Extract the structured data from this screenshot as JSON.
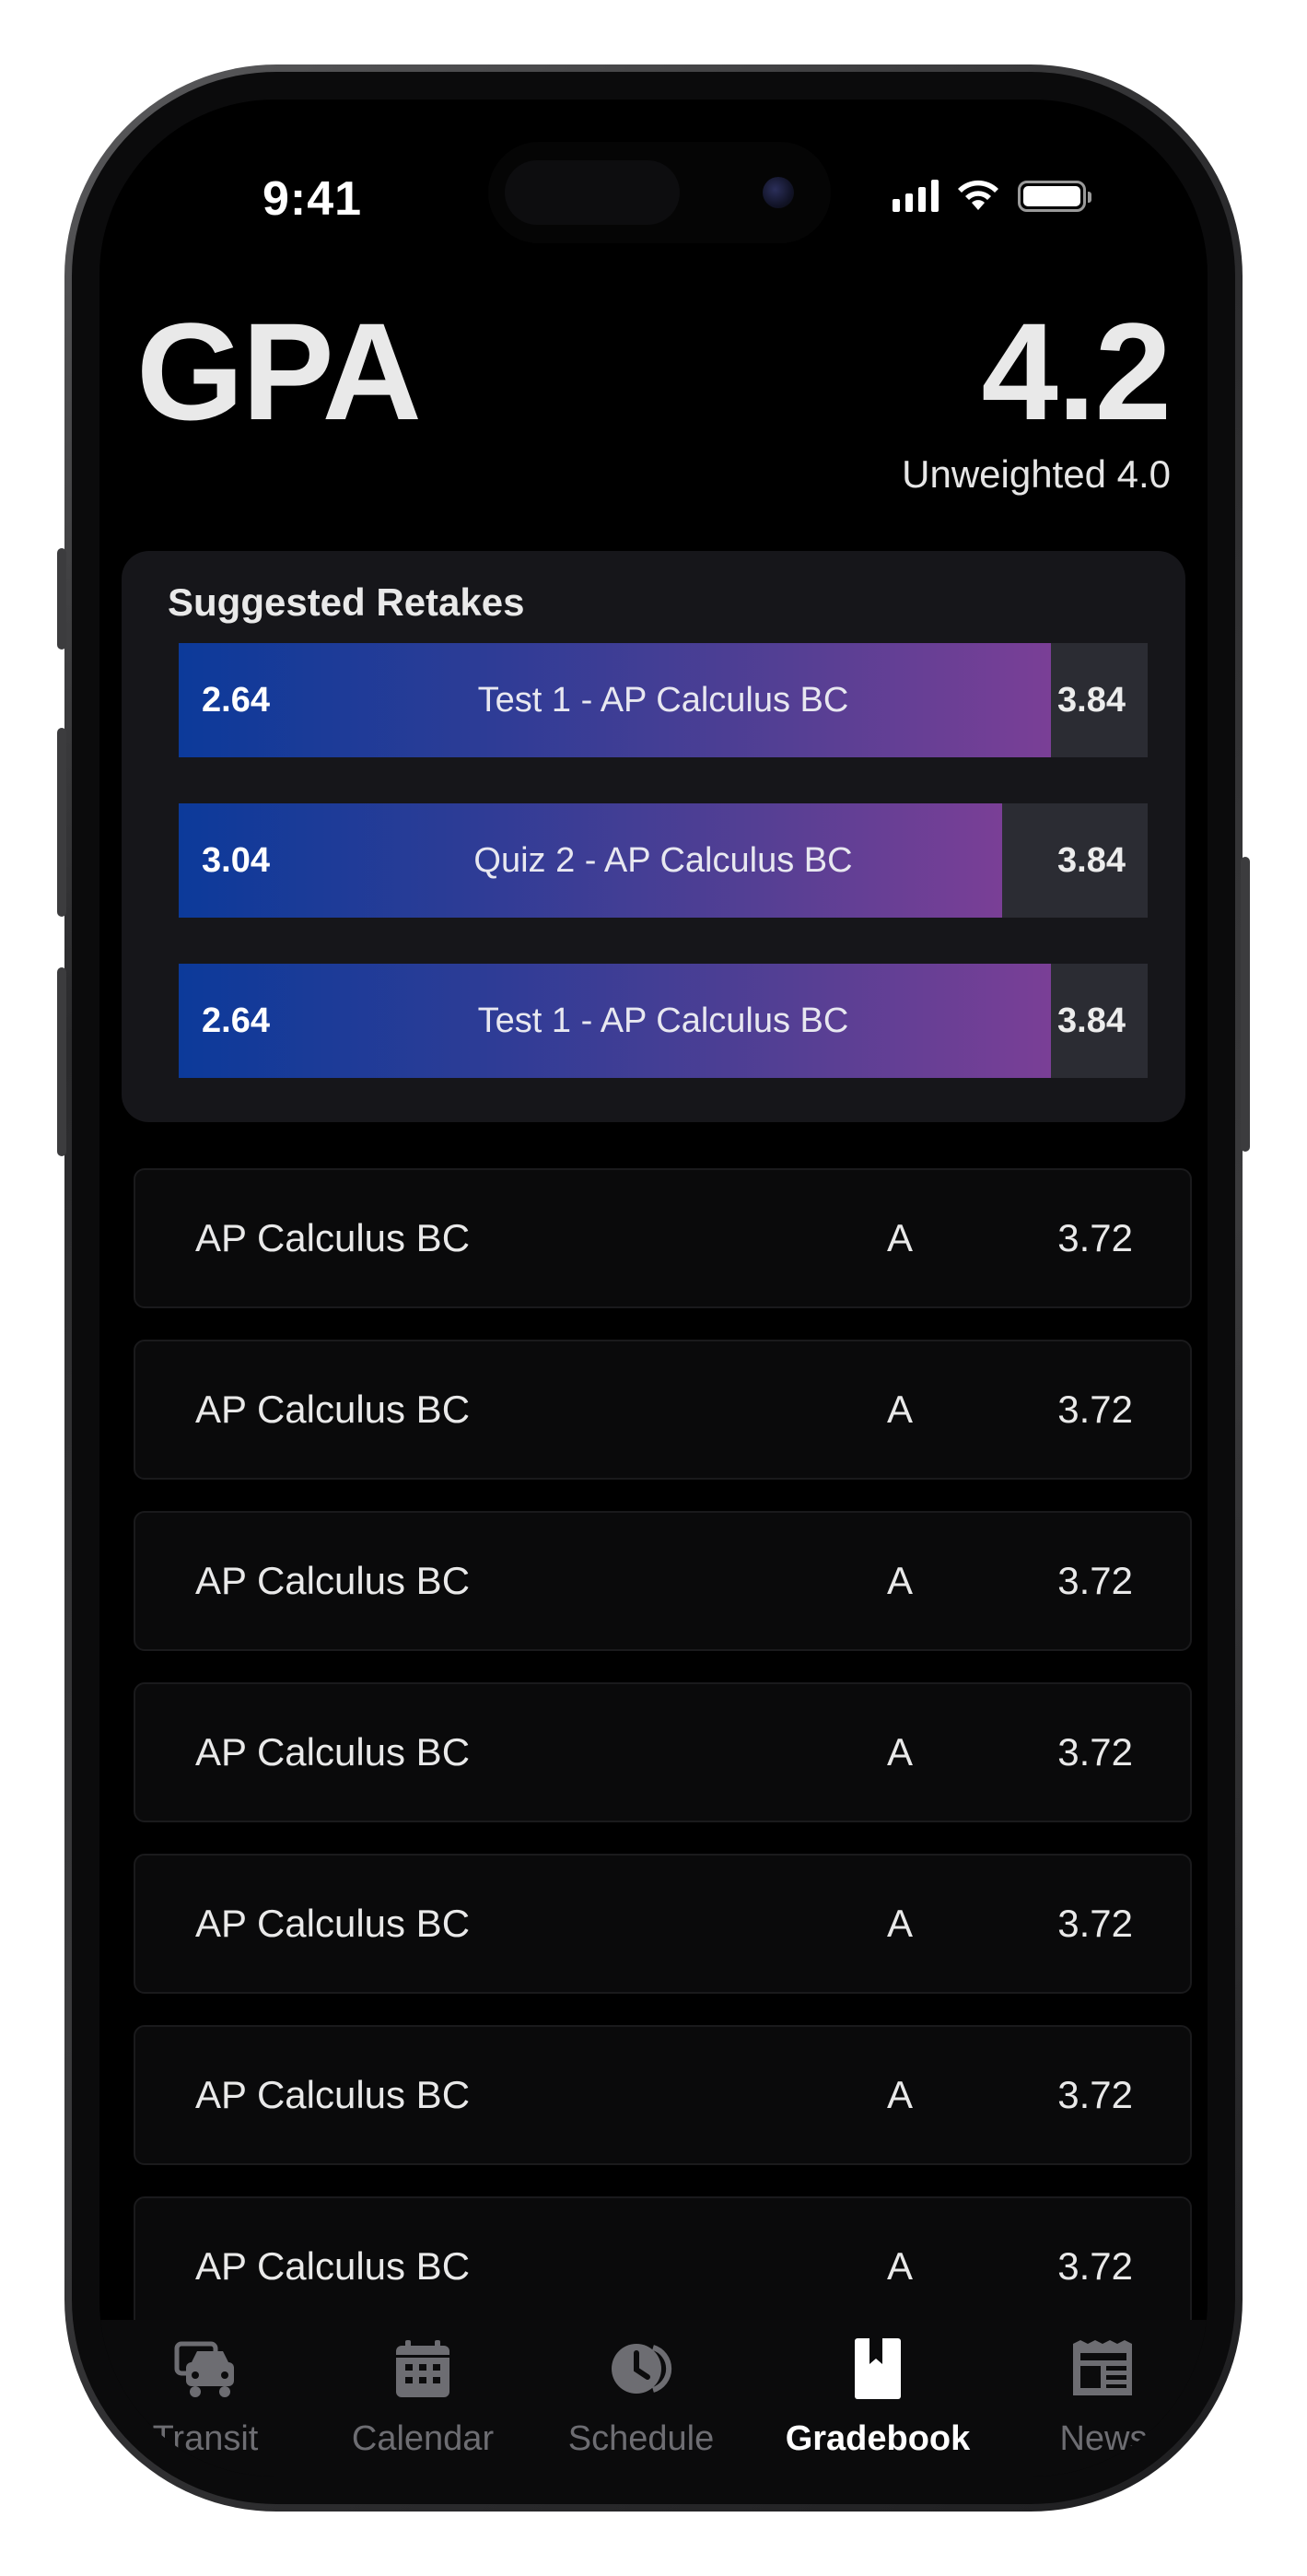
{
  "status_bar": {
    "time": "9:41"
  },
  "header": {
    "title": "GPA",
    "gpa": "4.2",
    "unweighted": "Unweighted 4.0"
  },
  "retakes": {
    "title": "Suggested Retakes",
    "items": [
      {
        "from": "2.64",
        "label": "Test 1 - AP Calculus BC",
        "to": "3.84",
        "progress": 0.9
      },
      {
        "from": "3.04",
        "label": "Quiz 2 - AP Calculus BC",
        "to": "3.84",
        "progress": 0.85
      },
      {
        "from": "2.64",
        "label": "Test 1 - AP Calculus BC",
        "to": "3.84",
        "progress": 0.9
      }
    ]
  },
  "classes": [
    {
      "name": "AP Calculus BC",
      "grade": "A",
      "gpa": "3.72"
    },
    {
      "name": "AP Calculus BC",
      "grade": "A",
      "gpa": "3.72"
    },
    {
      "name": "AP Calculus BC",
      "grade": "A",
      "gpa": "3.72"
    },
    {
      "name": "AP Calculus BC",
      "grade": "A",
      "gpa": "3.72"
    },
    {
      "name": "AP Calculus BC",
      "grade": "A",
      "gpa": "3.72"
    },
    {
      "name": "AP Calculus BC",
      "grade": "A",
      "gpa": "3.72"
    },
    {
      "name": "AP Calculus BC",
      "grade": "A",
      "gpa": "3.72"
    }
  ],
  "tabs": [
    {
      "label": "Transit",
      "icon": "car-icon",
      "active": false
    },
    {
      "label": "Calendar",
      "icon": "calendar-icon",
      "active": false
    },
    {
      "label": "Schedule",
      "icon": "clock-icon",
      "active": false
    },
    {
      "label": "Gradebook",
      "icon": "bookmark-icon",
      "active": true
    },
    {
      "label": "News",
      "icon": "newspaper-icon",
      "active": false
    }
  ],
  "colors": {
    "background": "#000000",
    "card": "#16161a",
    "gradient_start": "#0c3a9a",
    "gradient_end": "#7a3f96",
    "tab_inactive": "#6d6d72",
    "tab_active": "#ffffff"
  }
}
